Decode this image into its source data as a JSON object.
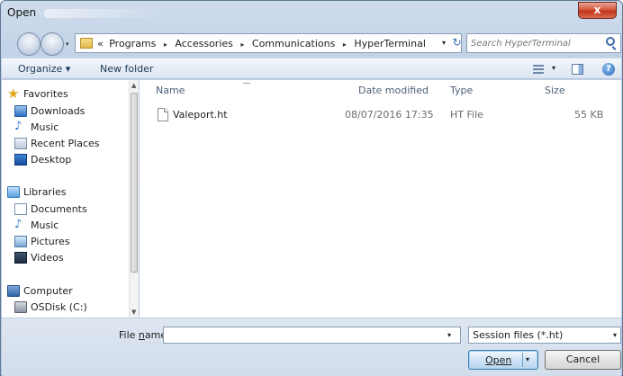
{
  "window": {
    "title": "Open",
    "close_glyph": "x"
  },
  "navigation": {
    "back_icon": "back-arrow-icon",
    "forward_icon": "forward-arrow-icon",
    "breadcrumb_prefix": "«",
    "breadcrumbs": [
      "Programs",
      "Accessories",
      "Communications",
      "HyperTerminal"
    ],
    "breadcrumb_separator": "▸",
    "dropdown_glyph": "▾",
    "refresh_glyph": "↻"
  },
  "search": {
    "placeholder": "Search HyperTerminal"
  },
  "toolbar": {
    "organize_label": "Organize ▾",
    "new_folder_label": "New folder",
    "view_dropdown_glyph": "▾",
    "help_glyph": "?"
  },
  "sidebar": {
    "groups": [
      {
        "label": "Favorites",
        "icon": "star-icon",
        "items": [
          {
            "label": "Downloads",
            "icon": "downloads-icon"
          },
          {
            "label": "Music",
            "icon": "music-icon"
          },
          {
            "label": "Recent Places",
            "icon": "recent-places-icon"
          },
          {
            "label": "Desktop",
            "icon": "desktop-icon"
          }
        ]
      },
      {
        "label": "Libraries",
        "icon": "libraries-icon",
        "items": [
          {
            "label": "Documents",
            "icon": "documents-icon"
          },
          {
            "label": "Music",
            "icon": "music-icon"
          },
          {
            "label": "Pictures",
            "icon": "pictures-icon"
          },
          {
            "label": "Videos",
            "icon": "videos-icon"
          }
        ]
      },
      {
        "label": "Computer",
        "icon": "computer-icon",
        "items": [
          {
            "label": "OSDisk (C:)",
            "icon": "disk-icon"
          }
        ]
      }
    ]
  },
  "file_list": {
    "columns": [
      "Name",
      "Date modified",
      "Type",
      "Size"
    ],
    "rows": [
      {
        "name": "Valeport.ht",
        "date_modified": "08/07/2016 17:35",
        "type": "HT File",
        "size": "55 KB"
      }
    ]
  },
  "footer": {
    "file_name_label_pre": "File ",
    "file_name_label_u": "n",
    "file_name_label_post": "ame:",
    "file_name_value": "",
    "file_type_value": "Session files (*.ht)",
    "open_label": "Open",
    "cancel_label": "Cancel"
  },
  "colors": {
    "accent": "#3c7fb1",
    "title_bar": "#cfdcec",
    "close_button": "#c2341a"
  }
}
